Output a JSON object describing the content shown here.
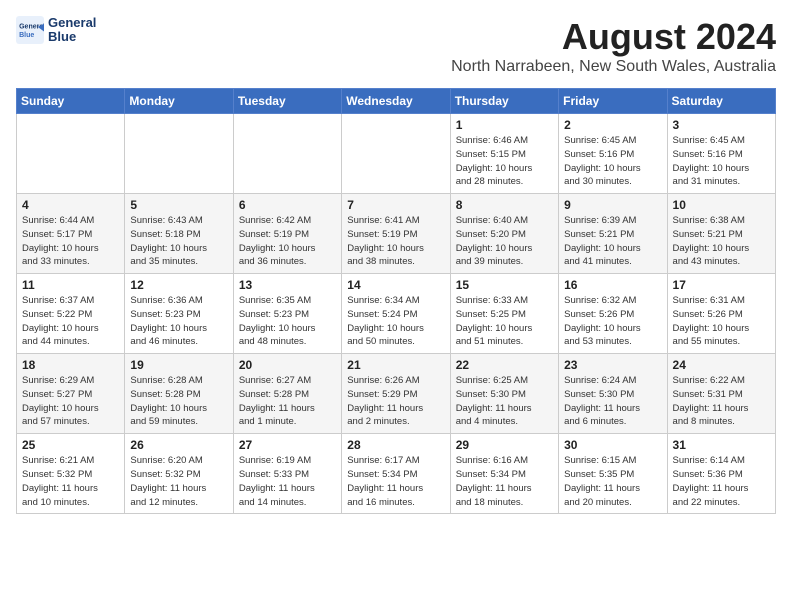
{
  "logo": {
    "line1": "General",
    "line2": "Blue"
  },
  "title": "August 2024",
  "location": "North Narrabeen, New South Wales, Australia",
  "days_of_week": [
    "Sunday",
    "Monday",
    "Tuesday",
    "Wednesday",
    "Thursday",
    "Friday",
    "Saturday"
  ],
  "weeks": [
    [
      {
        "day": "",
        "info": ""
      },
      {
        "day": "",
        "info": ""
      },
      {
        "day": "",
        "info": ""
      },
      {
        "day": "",
        "info": ""
      },
      {
        "day": "1",
        "info": "Sunrise: 6:46 AM\nSunset: 5:15 PM\nDaylight: 10 hours\nand 28 minutes."
      },
      {
        "day": "2",
        "info": "Sunrise: 6:45 AM\nSunset: 5:16 PM\nDaylight: 10 hours\nand 30 minutes."
      },
      {
        "day": "3",
        "info": "Sunrise: 6:45 AM\nSunset: 5:16 PM\nDaylight: 10 hours\nand 31 minutes."
      }
    ],
    [
      {
        "day": "4",
        "info": "Sunrise: 6:44 AM\nSunset: 5:17 PM\nDaylight: 10 hours\nand 33 minutes."
      },
      {
        "day": "5",
        "info": "Sunrise: 6:43 AM\nSunset: 5:18 PM\nDaylight: 10 hours\nand 35 minutes."
      },
      {
        "day": "6",
        "info": "Sunrise: 6:42 AM\nSunset: 5:19 PM\nDaylight: 10 hours\nand 36 minutes."
      },
      {
        "day": "7",
        "info": "Sunrise: 6:41 AM\nSunset: 5:19 PM\nDaylight: 10 hours\nand 38 minutes."
      },
      {
        "day": "8",
        "info": "Sunrise: 6:40 AM\nSunset: 5:20 PM\nDaylight: 10 hours\nand 39 minutes."
      },
      {
        "day": "9",
        "info": "Sunrise: 6:39 AM\nSunset: 5:21 PM\nDaylight: 10 hours\nand 41 minutes."
      },
      {
        "day": "10",
        "info": "Sunrise: 6:38 AM\nSunset: 5:21 PM\nDaylight: 10 hours\nand 43 minutes."
      }
    ],
    [
      {
        "day": "11",
        "info": "Sunrise: 6:37 AM\nSunset: 5:22 PM\nDaylight: 10 hours\nand 44 minutes."
      },
      {
        "day": "12",
        "info": "Sunrise: 6:36 AM\nSunset: 5:23 PM\nDaylight: 10 hours\nand 46 minutes."
      },
      {
        "day": "13",
        "info": "Sunrise: 6:35 AM\nSunset: 5:23 PM\nDaylight: 10 hours\nand 48 minutes."
      },
      {
        "day": "14",
        "info": "Sunrise: 6:34 AM\nSunset: 5:24 PM\nDaylight: 10 hours\nand 50 minutes."
      },
      {
        "day": "15",
        "info": "Sunrise: 6:33 AM\nSunset: 5:25 PM\nDaylight: 10 hours\nand 51 minutes."
      },
      {
        "day": "16",
        "info": "Sunrise: 6:32 AM\nSunset: 5:26 PM\nDaylight: 10 hours\nand 53 minutes."
      },
      {
        "day": "17",
        "info": "Sunrise: 6:31 AM\nSunset: 5:26 PM\nDaylight: 10 hours\nand 55 minutes."
      }
    ],
    [
      {
        "day": "18",
        "info": "Sunrise: 6:29 AM\nSunset: 5:27 PM\nDaylight: 10 hours\nand 57 minutes."
      },
      {
        "day": "19",
        "info": "Sunrise: 6:28 AM\nSunset: 5:28 PM\nDaylight: 10 hours\nand 59 minutes."
      },
      {
        "day": "20",
        "info": "Sunrise: 6:27 AM\nSunset: 5:28 PM\nDaylight: 11 hours\nand 1 minute."
      },
      {
        "day": "21",
        "info": "Sunrise: 6:26 AM\nSunset: 5:29 PM\nDaylight: 11 hours\nand 2 minutes."
      },
      {
        "day": "22",
        "info": "Sunrise: 6:25 AM\nSunset: 5:30 PM\nDaylight: 11 hours\nand 4 minutes."
      },
      {
        "day": "23",
        "info": "Sunrise: 6:24 AM\nSunset: 5:30 PM\nDaylight: 11 hours\nand 6 minutes."
      },
      {
        "day": "24",
        "info": "Sunrise: 6:22 AM\nSunset: 5:31 PM\nDaylight: 11 hours\nand 8 minutes."
      }
    ],
    [
      {
        "day": "25",
        "info": "Sunrise: 6:21 AM\nSunset: 5:32 PM\nDaylight: 11 hours\nand 10 minutes."
      },
      {
        "day": "26",
        "info": "Sunrise: 6:20 AM\nSunset: 5:32 PM\nDaylight: 11 hours\nand 12 minutes."
      },
      {
        "day": "27",
        "info": "Sunrise: 6:19 AM\nSunset: 5:33 PM\nDaylight: 11 hours\nand 14 minutes."
      },
      {
        "day": "28",
        "info": "Sunrise: 6:17 AM\nSunset: 5:34 PM\nDaylight: 11 hours\nand 16 minutes."
      },
      {
        "day": "29",
        "info": "Sunrise: 6:16 AM\nSunset: 5:34 PM\nDaylight: 11 hours\nand 18 minutes."
      },
      {
        "day": "30",
        "info": "Sunrise: 6:15 AM\nSunset: 5:35 PM\nDaylight: 11 hours\nand 20 minutes."
      },
      {
        "day": "31",
        "info": "Sunrise: 6:14 AM\nSunset: 5:36 PM\nDaylight: 11 hours\nand 22 minutes."
      }
    ]
  ]
}
